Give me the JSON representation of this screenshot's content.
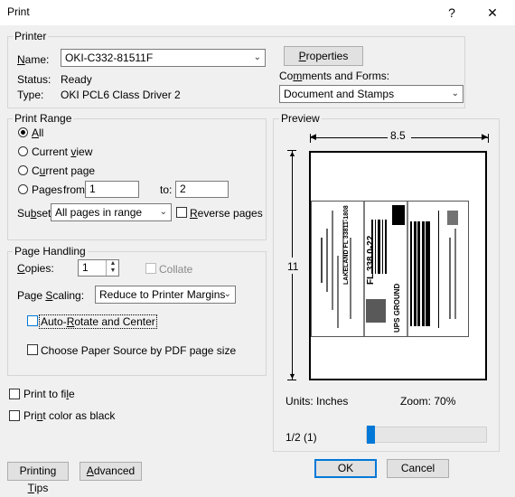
{
  "window": {
    "title": "Print",
    "help": "?",
    "close": "✕"
  },
  "printer": {
    "group_label": "Printer",
    "name_label": "Name:",
    "name_value": "OKI-C332-81511F",
    "status_label": "Status:",
    "status_value": "Ready",
    "type_label": "Type:",
    "type_value": "OKI PCL6 Class Driver 2",
    "properties_button": "Properties",
    "comments_label": "Comments and Forms:",
    "comments_value": "Document and Stamps"
  },
  "print_range": {
    "group_label": "Print Range",
    "all": "All",
    "current_view": "Current view",
    "current_page": "Current page",
    "pages": "Pages",
    "from_label": "from:",
    "from_value": "1",
    "to_label": "to:",
    "to_value": "2",
    "subset_label": "Subset:",
    "subset_value": "All pages in range",
    "reverse_pages": "Reverse pages"
  },
  "page_handling": {
    "group_label": "Page Handling",
    "copies_label": "Copies:",
    "copies_value": "1",
    "collate": "Collate",
    "scaling_label": "Page Scaling:",
    "scaling_value": "Reduce to Printer Margins",
    "auto_rotate": "Auto-Rotate and Center",
    "paper_source": "Choose Paper Source by PDF page size"
  },
  "options": {
    "print_to_file": "Print to file",
    "print_color_black": "Print color as black"
  },
  "preview": {
    "group_label": "Preview",
    "width_dim": "8.5",
    "height_dim": "11",
    "units": "Units: Inches",
    "zoom": "Zoom:  70%",
    "page_indicator": "1/2 (1)",
    "label_text": {
      "lakeland": "LAKELAND FL 33811-1808",
      "fl": "FL 338 0-22",
      "ups": "UPS GROUND"
    }
  },
  "footer": {
    "printing_tips": "Printing Tips",
    "advanced": "Advanced",
    "ok": "OK",
    "cancel": "Cancel"
  }
}
